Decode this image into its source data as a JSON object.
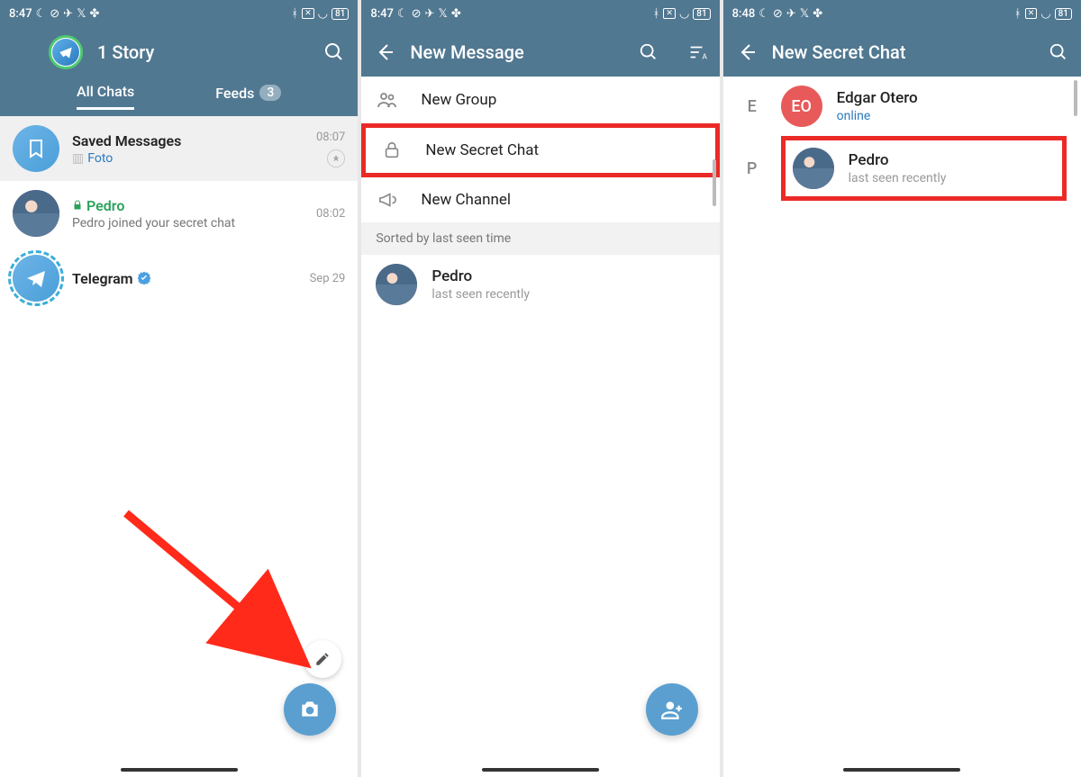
{
  "status": {
    "time_a": "8:47",
    "time_b": "8:48",
    "battery": "81"
  },
  "screen1": {
    "title": "1 Story",
    "tabs": {
      "all": "All Chats",
      "feeds": "Feeds",
      "feedsCount": "3"
    },
    "chats": [
      {
        "title": "Saved Messages",
        "sub_prefix": "",
        "sub": "Foto",
        "time": "08:07",
        "pinned": true
      },
      {
        "title": "Pedro",
        "sub": "Pedro joined your secret chat",
        "time": "08:02",
        "secret": true
      },
      {
        "title": "Telegram",
        "sub": "",
        "time": "Sep 29",
        "verified": true
      }
    ]
  },
  "screen2": {
    "title": "New Message",
    "menu": {
      "newGroup": "New Group",
      "newSecret": "New Secret Chat",
      "newChannel": "New Channel"
    },
    "sortLabel": "Sorted by last seen time",
    "contact": {
      "name": "Pedro",
      "status": "last seen recently"
    }
  },
  "screen3": {
    "title": "New Secret Chat",
    "sections": {
      "E": {
        "name": "Edgar Otero",
        "status": "online",
        "initials": "EO"
      },
      "P": {
        "name": "Pedro",
        "status": "last seen recently"
      }
    }
  }
}
